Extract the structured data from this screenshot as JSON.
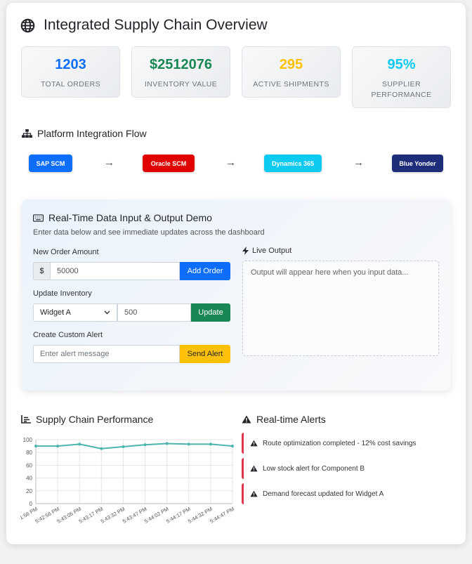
{
  "header": {
    "title": "Integrated Supply Chain Overview",
    "icon": "globe-icon"
  },
  "kpis": [
    {
      "value": "1203",
      "label": "TOTAL ORDERS",
      "color": "#0d6efd"
    },
    {
      "value": "$2512076",
      "label": "INVENTORY VALUE",
      "color": "#198754"
    },
    {
      "value": "295",
      "label": "ACTIVE SHIPMENTS",
      "color": "#ffc107"
    },
    {
      "value": "95%",
      "label": "SUPPLIER PERFORMANCE",
      "color": "#0dcaf0"
    }
  ],
  "flow": {
    "title": "Platform Integration Flow",
    "platforms": [
      {
        "label": "SAP SCM",
        "color": "#0d6efd"
      },
      {
        "label": "Oracle SCM",
        "color": "#dc0000"
      },
      {
        "label": "Dynamics 365",
        "color": "#0dcaf0"
      },
      {
        "label": "Blue Yonder",
        "color": "#1d2d7a"
      }
    ],
    "arrow": "→"
  },
  "demo": {
    "title": "Real-Time Data Input & Output Demo",
    "subtitle": "Enter data below and see immediate updates across the dashboard",
    "order": {
      "label": "New Order Amount",
      "prefix": "$",
      "value": "50000",
      "button": "Add Order"
    },
    "inventory": {
      "label": "Update Inventory",
      "selected": "Widget A",
      "value": "500",
      "button": "Update"
    },
    "alert": {
      "label": "Create Custom Alert",
      "placeholder": "Enter alert message",
      "button": "Send Alert"
    },
    "output": {
      "label": "Live Output",
      "placeholder": "Output will appear here when you input data..."
    }
  },
  "performance": {
    "title": "Supply Chain Performance"
  },
  "alerts": {
    "title": "Real-time Alerts",
    "items": [
      "Route optimization completed - 12% cost savings",
      "Low stock alert for Component B",
      "Demand forecast updated for Widget A"
    ]
  },
  "chart_data": {
    "type": "line",
    "x": [
      "5:41:56 PM",
      "5:42:56 PM",
      "5:43:05 PM",
      "5:43:17 PM",
      "5:43:32 PM",
      "5:43:47 PM",
      "5:44:02 PM",
      "5:44:17 PM",
      "5:44:32 PM",
      "5:44:47 PM"
    ],
    "series": [
      {
        "values": [
          90,
          90,
          93,
          86,
          89,
          92,
          94,
          93,
          93,
          90
        ],
        "color": "#4bb5ad"
      }
    ],
    "ylim": [
      0,
      100
    ],
    "yticks": [
      0,
      20,
      40,
      60,
      80,
      100
    ],
    "grid": true
  }
}
